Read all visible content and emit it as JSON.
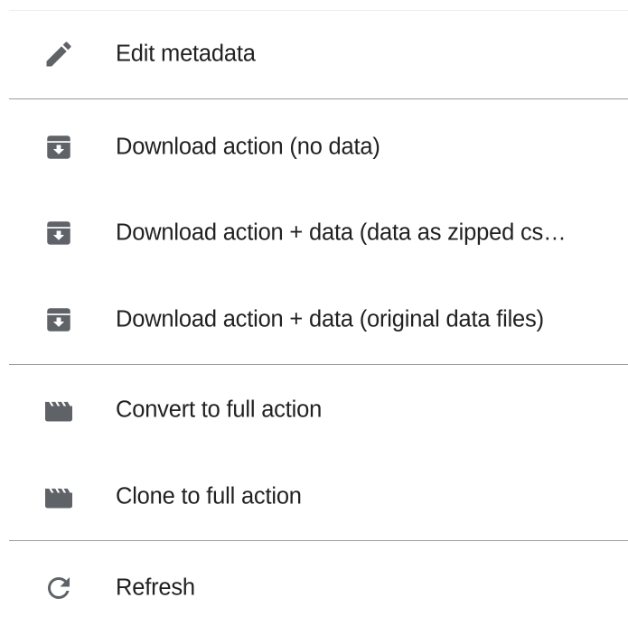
{
  "menu": {
    "items": [
      {
        "label": "Edit metadata",
        "icon": "pencil-icon"
      },
      {
        "label": "Download action (no data)",
        "icon": "archive-icon"
      },
      {
        "label": "Download action + data (data as zipped cs…",
        "icon": "archive-icon"
      },
      {
        "label": "Download action + data (original data files)",
        "icon": "archive-icon"
      },
      {
        "label": "Convert to full action",
        "icon": "clapperboard-icon"
      },
      {
        "label": "Clone to full action",
        "icon": "clapperboard-icon"
      },
      {
        "label": "Refresh",
        "icon": "refresh-icon"
      }
    ]
  },
  "colors": {
    "icon": "#5f6368",
    "text": "#212121",
    "divider": "#9c9c9c"
  }
}
